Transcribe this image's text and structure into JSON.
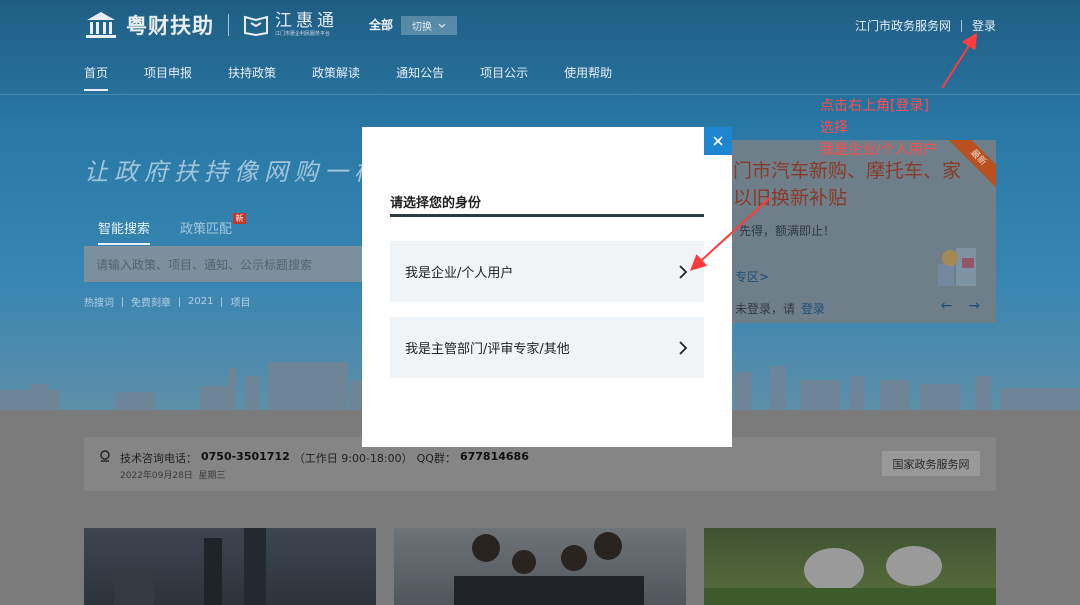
{
  "header": {
    "logo_text": "粤财扶助",
    "brand_title": "江惠通",
    "brand_subtitle": "江门市惠企利民服务平台",
    "region_label": "全部",
    "switch_label": "切换",
    "gov_portal_link": "江门市政务服务网",
    "login_link": "登录"
  },
  "nav": {
    "items": [
      {
        "label": "首页",
        "active": true
      },
      {
        "label": "项目申报",
        "active": false
      },
      {
        "label": "扶持政策",
        "active": false
      },
      {
        "label": "政策解读",
        "active": false
      },
      {
        "label": "通知公告",
        "active": false
      },
      {
        "label": "项目公示",
        "active": false
      },
      {
        "label": "使用帮助",
        "active": false
      }
    ]
  },
  "hero": {
    "slogan": "让政府扶持像网购一样",
    "search_tabs": [
      {
        "label": "智能搜索",
        "active": true
      },
      {
        "label": "政策匹配",
        "active": false,
        "badge": "新"
      }
    ],
    "search_placeholder": "请输入政策、项目、通知、公示标题搜索",
    "hot_words_label": "热搜词",
    "hot_words": [
      "免费刻章",
      "2021",
      "项目"
    ]
  },
  "promo": {
    "title": "门市汽车新购、摩托车、家以旧换新补贴",
    "ribbon": "最新",
    "line1": "先得，额满即止！",
    "line2": "专区>",
    "line3_prefix": "未登录，请",
    "line3_login": "登录",
    "prev_arrow": "←",
    "next_arrow": "→"
  },
  "info_bar": {
    "phone_label": "技术咨询电话：",
    "phone": "0750-3501712",
    "hours": "（工作日 9:00-18:00）",
    "qq_label": "QQ群：",
    "qq": "677814686",
    "date": "2022年09月28日",
    "weekday": "星期三",
    "national_portal_button": "国家政务服务网"
  },
  "modal": {
    "title": "请选择您的身份",
    "close_icon": "close-icon",
    "options": [
      {
        "label": "我是企业/个人用户"
      },
      {
        "label": "我是主管部门/评审专家/其他"
      }
    ]
  },
  "annotation": {
    "lines": [
      "点击右上角[登录]",
      "选择",
      "我是企业/个人用户"
    ],
    "color": "#ff4d4d"
  },
  "colors": {
    "accent": "#1e86d1",
    "annotation_red": "#ff4d4d"
  }
}
